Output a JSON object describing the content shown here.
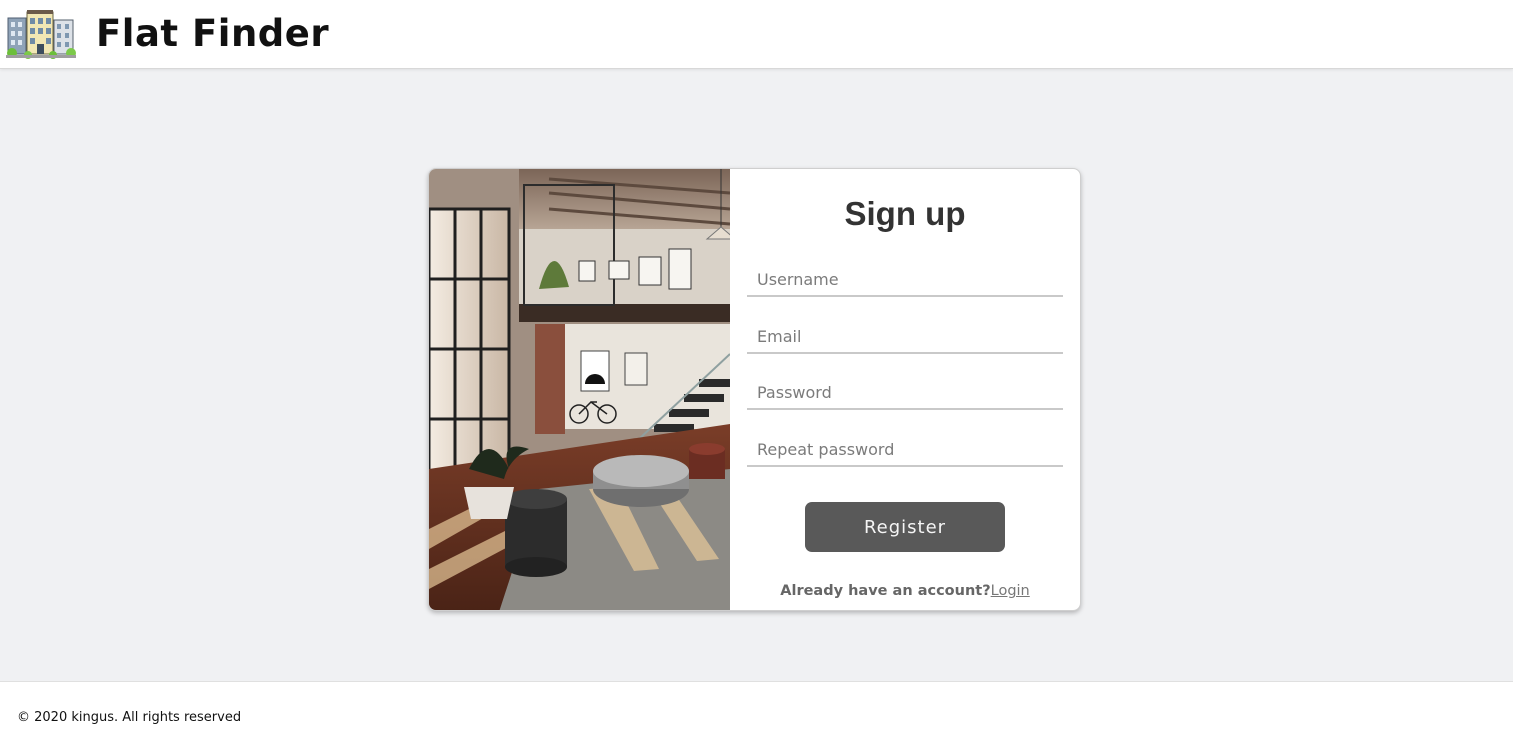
{
  "header": {
    "brand": "Flat Finder",
    "logo_icon": "apartment-building-icon"
  },
  "signup": {
    "title": "Sign up",
    "fields": {
      "username": {
        "placeholder": "Username",
        "value": ""
      },
      "email": {
        "placeholder": "Email",
        "value": ""
      },
      "password": {
        "placeholder": "Password",
        "value": ""
      },
      "repeat_password": {
        "placeholder": "Repeat password",
        "value": ""
      }
    },
    "register_label": "Register",
    "already_text": "Already have an account?",
    "login_link": "Login",
    "illustration": "loft-interior-photo"
  },
  "footer": {
    "copyright": "© 2020 kingus. All rights reserved"
  },
  "colors": {
    "page_background": "#f0f1f3",
    "button_background": "#595959",
    "button_text": "#f5f5f5",
    "title_text": "#333333"
  }
}
